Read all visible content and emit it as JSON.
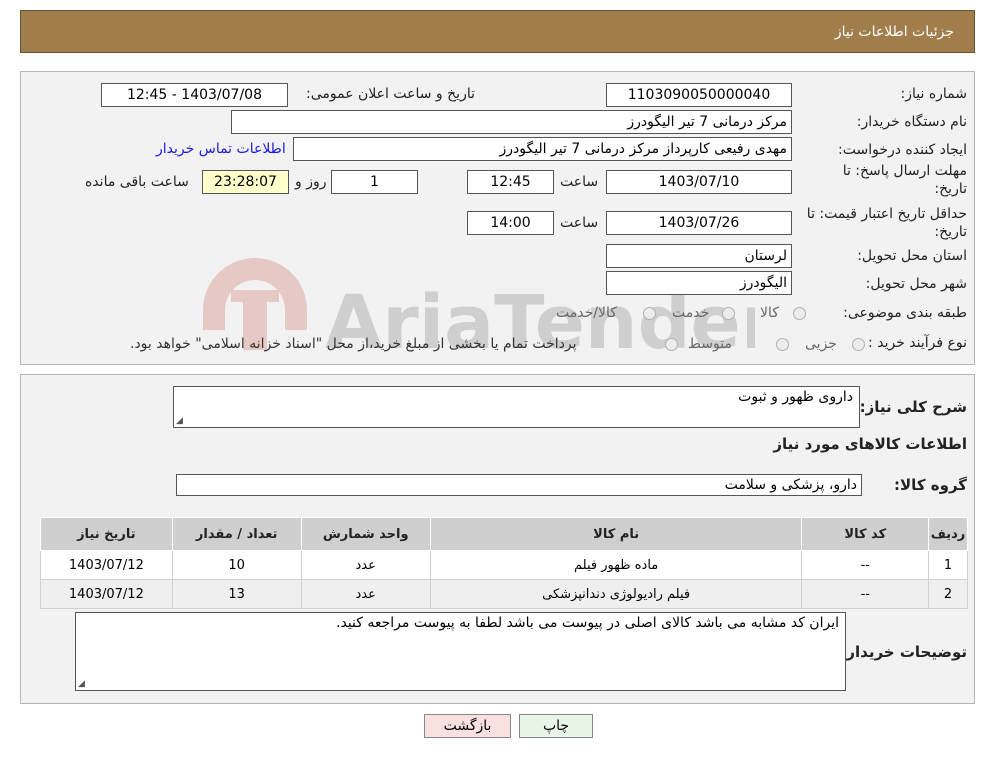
{
  "header": {
    "title": "جزئیات اطلاعات نیاز"
  },
  "form": {
    "need_number_label": "شماره نیاز:",
    "need_number": "1103090050000040",
    "announce_label": "تاریخ و ساعت اعلان عمومی:",
    "announce_value": "1403/07/08 - 12:45",
    "buyer_label": "نام دستگاه خریدار:",
    "buyer_value": "مرکز درمانی 7 تیر الیگودرز",
    "creator_label": "ایجاد کننده درخواست:",
    "creator_value": "مهدی رفیعی کارپرداز مرکز درمانی 7 تیر الیگودرز",
    "contact_link": "اطلاعات تماس خریدار",
    "deadline_label_1": "مهلت ارسال پاسخ: تا",
    "deadline_label_2": "تاریخ:",
    "deadline_date": "1403/07/10",
    "time_label": "ساعت",
    "deadline_time": "12:45",
    "days_value": "1",
    "days_label": "روز و",
    "remaining_value": "23:28:07",
    "remaining_label": "ساعت باقی مانده",
    "validity_label_1": "حداقل تاریخ اعتبار قیمت: تا",
    "validity_label_2": "تاریخ:",
    "validity_date": "1403/07/26",
    "validity_time": "14:00",
    "province_label": "استان محل تحویل:",
    "province_value": "لرستان",
    "city_label": "شهر محل تحویل:",
    "city_value": "الیگودرز",
    "category_label": "طبقه بندی موضوعی:",
    "category_options": [
      "کالا",
      "خدمت",
      "کالا/خدمت"
    ],
    "process_label": "نوع فرآیند خرید :",
    "process_options": [
      "جزیی",
      "متوسط"
    ],
    "payment_note": "پرداخت تمام یا بخشی از مبلغ خرید،از محل \"اسناد خزانه اسلامی\" خواهد بود."
  },
  "details": {
    "description_label": "شرح کلی نیاز:",
    "description_value": "داروی ظهور و ثبوت",
    "goods_info_title": "اطلاعات کالاهای مورد نیاز",
    "group_label": "گروه کالا:",
    "group_value": "دارو، پزشکی و سلامت",
    "table": {
      "headers": [
        "ردیف",
        "کد کالا",
        "نام کالا",
        "واحد شمارش",
        "تعداد / مقدار",
        "تاریخ نیاز"
      ],
      "rows": [
        [
          "1",
          "--",
          "ماده ظهور فیلم",
          "عدد",
          "10",
          "1403/07/12"
        ],
        [
          "2",
          "--",
          "فیلم رادیولوژی دندانپزشکی",
          "عدد",
          "13",
          "1403/07/12"
        ]
      ]
    },
    "buyer_notes_label": "توضیحات خریدار:",
    "buyer_notes_value": "ایران کد مشابه می باشد کالای اصلی در پیوست می باشد لطفا به پیوست مراجعه کنید."
  },
  "buttons": {
    "print": "چاپ",
    "back": "بازگشت"
  },
  "watermark": "AriaTender.neT",
  "colors": {
    "header": "#a07d4b",
    "panel": "#f2f2f2",
    "link": "#1a1adc",
    "remaining": "#ffffcc",
    "print_btn": "#e8f6e8",
    "back_btn": "#fbe0e0"
  }
}
